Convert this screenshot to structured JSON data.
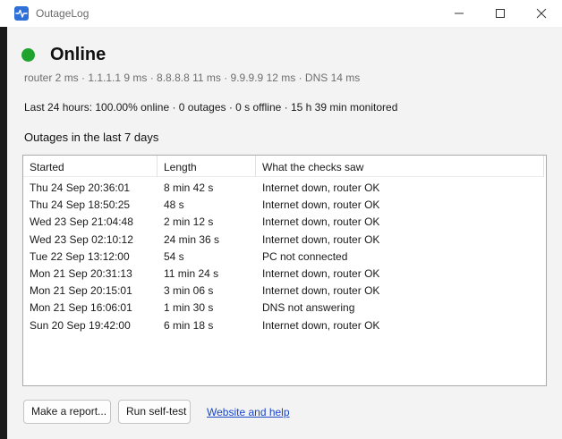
{
  "window": {
    "title": "OutageLog"
  },
  "status": {
    "state": "Online",
    "color": "#1fa32e",
    "pings": "router 2 ms · 1.1.1.1 9 ms · 8.8.8.8 11 ms · 9.9.9.9 12 ms · DNS 14 ms",
    "summary": "Last 24 hours: 100.00% online · 0 outages · 0 s offline · 15 h 39 min monitored"
  },
  "outages": {
    "title": "Outages in the last 7 days",
    "columns": [
      "Started",
      "Length",
      "What the checks saw"
    ],
    "rows": [
      [
        "Thu 24 Sep 20:36:01",
        "8 min 42 s",
        "Internet down, router OK"
      ],
      [
        "Thu 24 Sep 18:50:25",
        "48 s",
        "Internet down, router OK"
      ],
      [
        "Wed 23 Sep 21:04:48",
        "2 min 12 s",
        "Internet down, router OK"
      ],
      [
        "Wed 23 Sep 02:10:12",
        "24 min 36 s",
        "Internet down, router OK"
      ],
      [
        "Tue 22 Sep 13:12:00",
        "54 s",
        "PC not connected"
      ],
      [
        "Mon 21 Sep 20:31:13",
        "11 min 24 s",
        "Internet down, router OK"
      ],
      [
        "Mon 21 Sep 20:15:01",
        "3 min 06 s",
        "Internet down, router OK"
      ],
      [
        "Mon 21 Sep 16:06:01",
        "1 min 30 s",
        "DNS not answering"
      ],
      [
        "Sun 20 Sep 19:42:00",
        "6 min 18 s",
        "Internet down, router OK"
      ]
    ]
  },
  "actions": {
    "report": "Make a report...",
    "selftest": "Run self-test",
    "help": "Website and help"
  }
}
